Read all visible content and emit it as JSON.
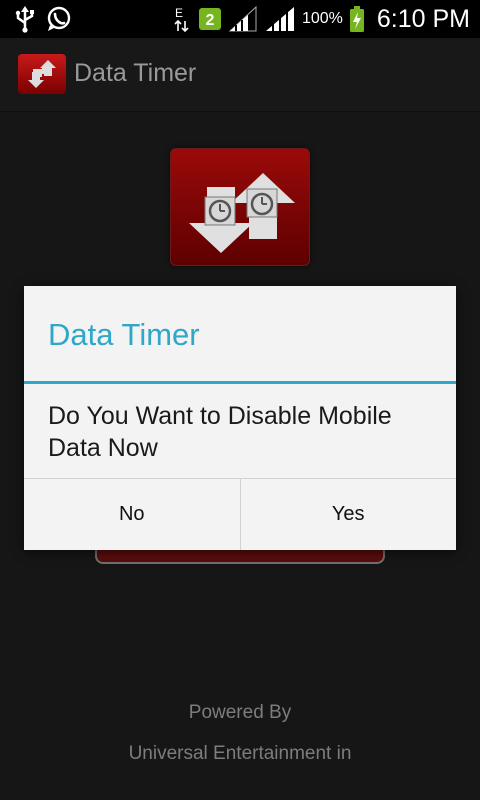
{
  "status_bar": {
    "left_icons": [
      "usb-icon",
      "whatsapp-icon"
    ],
    "network_badge": "E",
    "notification_count": "2",
    "battery_text": "100%",
    "time": "6:10 PM"
  },
  "action_bar": {
    "title": "Data Timer",
    "icon": "data-timer-app-icon"
  },
  "dialog": {
    "title": "Data Timer",
    "message": "Do You Want to Disable Mobile Data Now",
    "buttons": {
      "no": "No",
      "yes": "Yes"
    },
    "accent": "#2fa7c7"
  },
  "footer": {
    "powered_by": "Powered By",
    "company": "Universal Entertainment in"
  },
  "colors": {
    "background": "#161616",
    "brand_red": "#a30000",
    "dialog_bg": "#f3f3f3"
  }
}
